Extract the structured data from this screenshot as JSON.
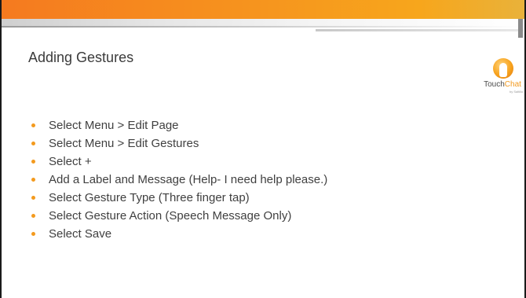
{
  "slide": {
    "title": "Adding Gestures",
    "bullets": [
      "Select Menu > Edit Page",
      "Select Menu > Edit Gestures",
      "Select +",
      "Add a Label and Message (Help- I need help please.)",
      "Select Gesture Type (Three finger tap)",
      "Select Gesture Action (Speech Message Only)",
      "Select Save"
    ]
  },
  "logo": {
    "name_part1": "Touch",
    "name_part2": "Chat",
    "tagline": "by Saltillo",
    "icon": "touchchat-hand-logo-icon"
  },
  "colors": {
    "accent": "#f39a1e",
    "bar": "#f6921e",
    "text": "#404040"
  }
}
